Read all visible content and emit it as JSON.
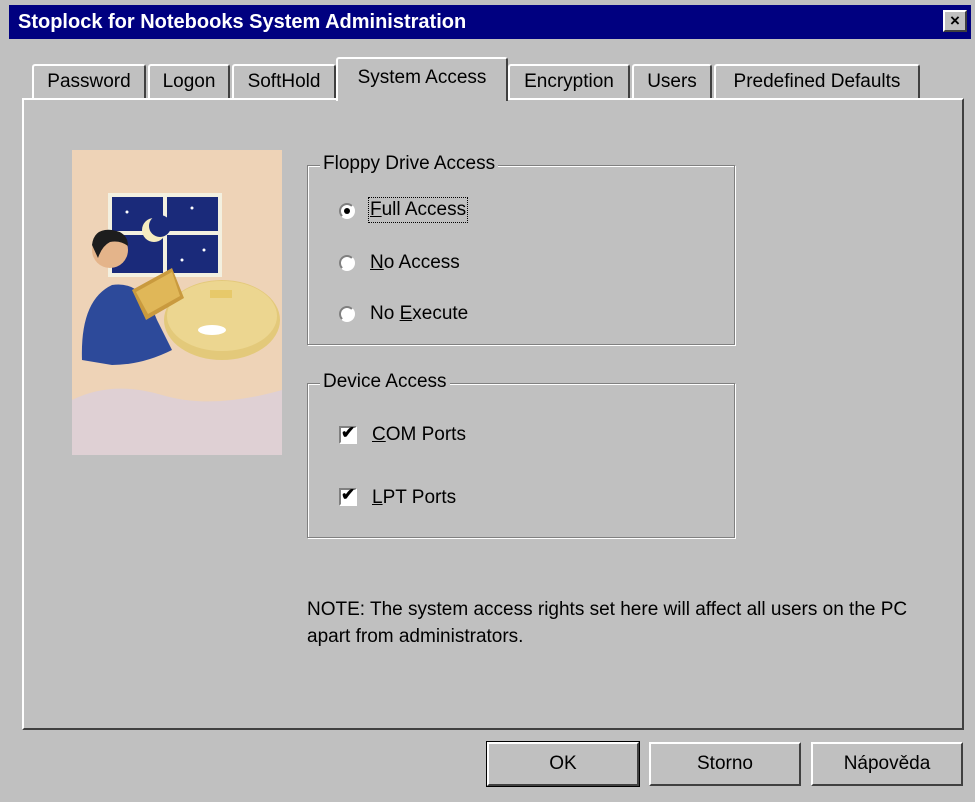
{
  "window": {
    "title": "Stoplock for Notebooks System Administration",
    "close_glyph": "×"
  },
  "tabs": [
    {
      "label": "Password",
      "active": false
    },
    {
      "label": "Logon",
      "active": false
    },
    {
      "label": "SoftHold",
      "active": false
    },
    {
      "label": "System Access",
      "active": true
    },
    {
      "label": "Encryption",
      "active": false
    },
    {
      "label": "Users",
      "active": false
    },
    {
      "label": "Predefined Defaults",
      "active": false
    }
  ],
  "illustration": {
    "icon": "man-with-notebook-illustration"
  },
  "floppy": {
    "label": "Floppy Drive Access",
    "options": [
      {
        "mnemonic": "F",
        "rest": "ull Access",
        "checked": true
      },
      {
        "mnemonic": "N",
        "rest": "o Access",
        "checked": false
      },
      {
        "pre": "No ",
        "mnemonic": "E",
        "rest": "xecute",
        "checked": false
      }
    ]
  },
  "device": {
    "label": "Device Access",
    "options": [
      {
        "mnemonic": "C",
        "rest": "OM Ports",
        "checked": true
      },
      {
        "mnemonic": "L",
        "rest": "PT Ports",
        "checked": true
      }
    ]
  },
  "note": "NOTE: The system access rights set here will affect all users on the PC apart from administrators.",
  "buttons": {
    "ok": "OK",
    "cancel": "Storno",
    "help": "Nápověda"
  },
  "colors": {
    "face": "#c0c0c0",
    "titlebar": "#000080"
  }
}
